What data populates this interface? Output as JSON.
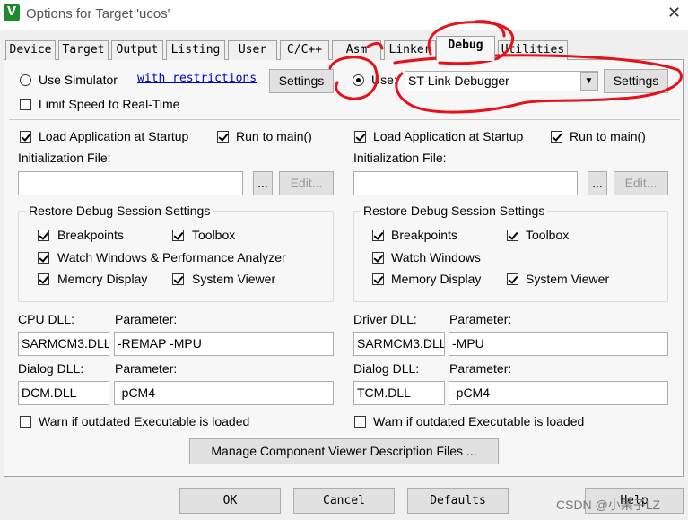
{
  "window": {
    "title": "Options for Target 'ucos'",
    "icon": "keil-v-icon"
  },
  "tabs": [
    "Device",
    "Target",
    "Output",
    "Listing",
    "User",
    "C/C++",
    "Asm",
    "Linker",
    "Debug",
    "Utilities"
  ],
  "active_tab": "Debug",
  "left": {
    "use_simulator": "Use Simulator",
    "with_restrictions": "with restrictions",
    "settings": "Settings",
    "limit_speed": "Limit Speed to Real-Time",
    "load_app": "Load Application at Startup",
    "run_to_main": "Run to main()",
    "init_file_label": "Initialization File:",
    "init_file_value": "",
    "browse": "...",
    "edit": "Edit...",
    "restore_title": "Restore Debug Session Settings",
    "breakpoints": "Breakpoints",
    "toolbox": "Toolbox",
    "watch": "Watch Windows & Performance Analyzer",
    "memory": "Memory Display",
    "system_viewer": "System Viewer",
    "dll_label": "CPU DLL:",
    "param_label": "Parameter:",
    "dll_value": "SARMCM3.DLL",
    "param_value": "-REMAP -MPU",
    "dialog_dll_label": "Dialog DLL:",
    "dialog_param_label": "Parameter:",
    "dialog_dll_value": "DCM.DLL",
    "dialog_param_value": "-pCM4",
    "warn": "Warn if outdated Executable is loaded"
  },
  "right": {
    "use": "Use:",
    "debugger": "ST-Link Debugger",
    "settings": "Settings",
    "load_app": "Load Application at Startup",
    "run_to_main": "Run to main()",
    "init_file_label": "Initialization File:",
    "init_file_value": "",
    "browse": "...",
    "edit": "Edit...",
    "restore_title": "Restore Debug Session Settings",
    "breakpoints": "Breakpoints",
    "toolbox": "Toolbox",
    "watch": "Watch Windows",
    "memory": "Memory Display",
    "system_viewer": "System Viewer",
    "dll_label": "Driver DLL:",
    "param_label": "Parameter:",
    "dll_value": "SARMCM3.DLL",
    "param_value": "-MPU",
    "dialog_dll_label": "Dialog DLL:",
    "dialog_param_label": "Parameter:",
    "dialog_dll_value": "TCM.DLL",
    "dialog_param_value": "-pCM4",
    "warn": "Warn if outdated Executable is loaded"
  },
  "manage_button": "Manage Component Viewer Description Files ...",
  "buttons": {
    "ok": "OK",
    "cancel": "Cancel",
    "defaults": "Defaults",
    "help": "Help"
  },
  "watermark": "CSDN @小果子LZ",
  "annotation_color": "#e8101a"
}
